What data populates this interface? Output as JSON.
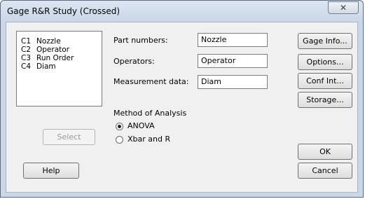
{
  "window": {
    "title": "Gage R&R Study (Crossed)",
    "close_glyph": "✕"
  },
  "column_list": [
    {
      "col": "C1",
      "name": "Nozzle"
    },
    {
      "col": "C2",
      "name": "Operator"
    },
    {
      "col": "C3",
      "name": "Run Order"
    },
    {
      "col": "C4",
      "name": "Diam"
    }
  ],
  "fields": {
    "part_numbers": {
      "label": "Part numbers:",
      "value": "Nozzle"
    },
    "operators": {
      "label": "Operators:",
      "value": "Operator"
    },
    "measurement_data": {
      "label": "Measurement data:",
      "value": "Diam"
    }
  },
  "method": {
    "label": "Method of Analysis",
    "options": [
      {
        "label": "ANOVA",
        "selected": true
      },
      {
        "label": "Xbar and R",
        "selected": false
      }
    ]
  },
  "buttons": {
    "select": "Select",
    "help": "Help",
    "gage_info": "Gage Info...",
    "options": "Options...",
    "conf_int": "Conf Int...",
    "storage": "Storage...",
    "ok": "OK",
    "cancel": "Cancel"
  },
  "icons": {
    "close": "close-icon",
    "radio_selected": "radio-selected-icon",
    "radio_unselected": "radio-unselected-icon"
  }
}
